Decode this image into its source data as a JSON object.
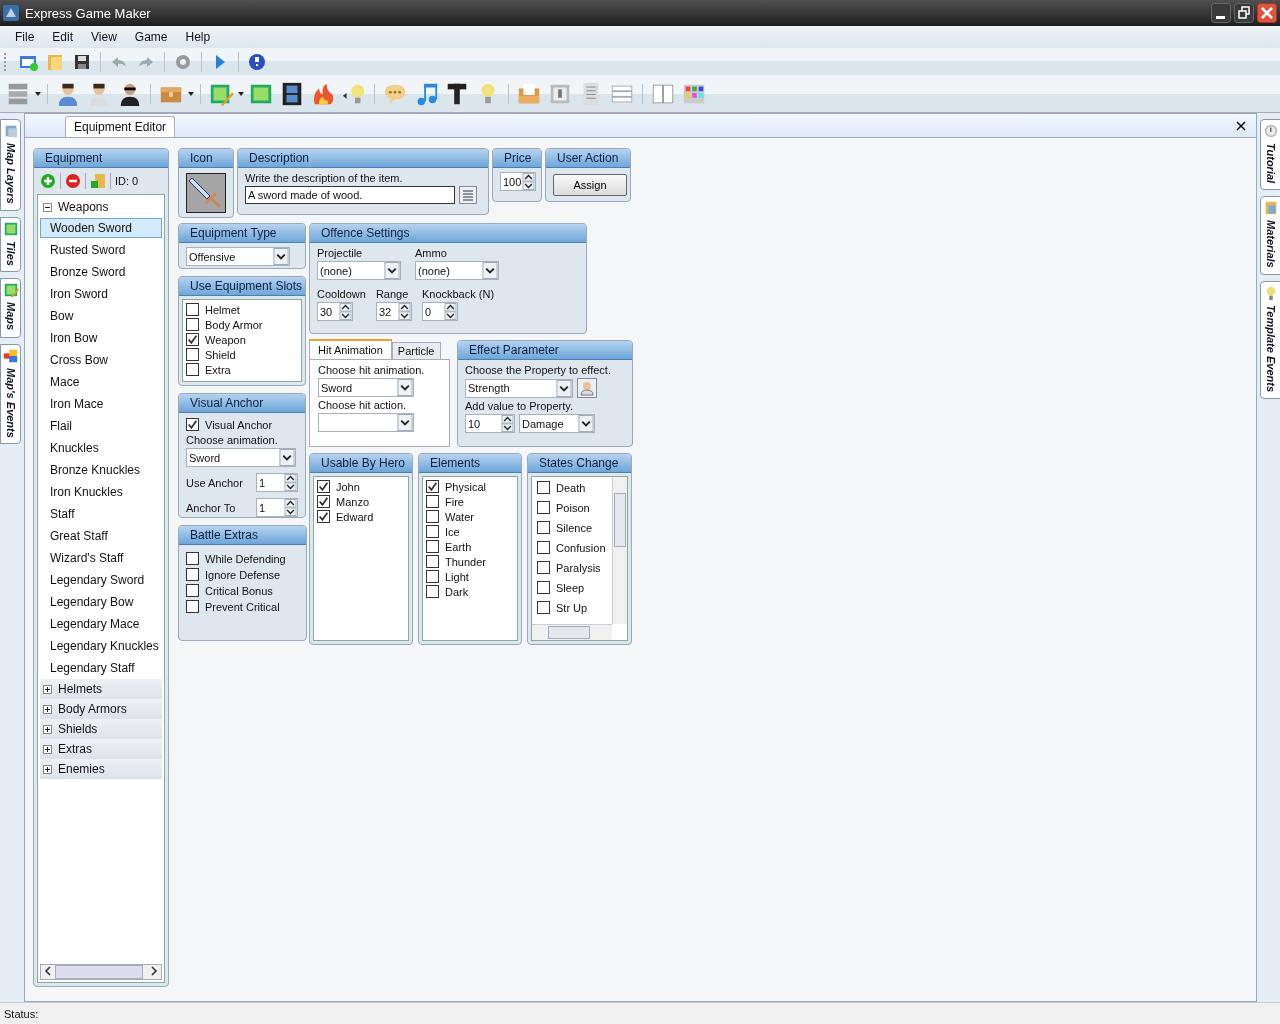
{
  "window": {
    "title": "Express Game Maker"
  },
  "menu": [
    "File",
    "Edit",
    "View",
    "Game",
    "Help"
  ],
  "left_dock_tabs": [
    "Map Layers",
    "Tiles",
    "Maps",
    "Map's Events"
  ],
  "right_dock_tabs": [
    "Tutorial",
    "Materials",
    "Template Events"
  ],
  "document_tab": {
    "label": "Equipment Editor"
  },
  "equipment": {
    "title": "Equipment",
    "id_label": "ID: 0",
    "tree": [
      {
        "label": "Weapons",
        "expanded": true,
        "children": [
          {
            "label": "Wooden Sword",
            "selected": true
          },
          {
            "label": "Rusted Sword",
            "selected": false
          },
          {
            "label": "Bronze Sword",
            "selected": false
          },
          {
            "label": "Iron Sword",
            "selected": false
          },
          {
            "label": "Bow",
            "selected": false
          },
          {
            "label": "Iron Bow",
            "selected": false
          },
          {
            "label": "Cross Bow",
            "selected": false
          },
          {
            "label": "Mace",
            "selected": false
          },
          {
            "label": "Iron Mace",
            "selected": false
          },
          {
            "label": "Flail",
            "selected": false
          },
          {
            "label": "Knuckles",
            "selected": false
          },
          {
            "label": "Bronze Knuckles",
            "selected": false
          },
          {
            "label": "Iron Knuckles",
            "selected": false
          },
          {
            "label": "Staff",
            "selected": false
          },
          {
            "label": "Great Staff",
            "selected": false
          },
          {
            "label": "Wizard's Staff",
            "selected": false
          },
          {
            "label": "Legendary Sword",
            "selected": false
          },
          {
            "label": "Legendary Bow",
            "selected": false
          },
          {
            "label": "Legendary Mace",
            "selected": false
          },
          {
            "label": "Legendary Knuckles",
            "selected": false
          },
          {
            "label": "Legendary Staff",
            "selected": false
          }
        ]
      },
      {
        "label": "Helmets",
        "expanded": false
      },
      {
        "label": "Body Armors",
        "expanded": false
      },
      {
        "label": "Shields",
        "expanded": false
      },
      {
        "label": "Extras",
        "expanded": false
      },
      {
        "label": "Enemies",
        "expanded": false
      }
    ]
  },
  "icon": {
    "title": "Icon"
  },
  "description": {
    "title": "Description",
    "hint": "Write the description of the item.",
    "value": "A sword made of wood."
  },
  "price": {
    "title": "Price",
    "value": "100"
  },
  "user_action": {
    "title": "User Action",
    "button": "Assign"
  },
  "equipment_type": {
    "title": "Equipment Type",
    "value": "Offensive"
  },
  "equipment_slots": {
    "title": "Use Equipment Slots",
    "items": [
      {
        "label": "Helmet",
        "checked": false
      },
      {
        "label": "Body Armor",
        "checked": false
      },
      {
        "label": "Weapon",
        "checked": true
      },
      {
        "label": "Shield",
        "checked": false
      },
      {
        "label": "Extra",
        "checked": false
      }
    ]
  },
  "visual_anchor": {
    "title": "Visual Anchor",
    "enabled": {
      "label": "Visual Anchor",
      "checked": true
    },
    "animation_label": "Choose animation.",
    "animation": "Sword",
    "spinners": [
      {
        "label": "Use Anchor",
        "value": "1"
      },
      {
        "label": "Anchor To",
        "value": "1"
      }
    ]
  },
  "battle_extras": {
    "title": "Battle Extras",
    "items": [
      {
        "label": "While Defending",
        "checked": false
      },
      {
        "label": "Ignore Defense",
        "checked": false
      },
      {
        "label": "Critical Bonus",
        "checked": false
      },
      {
        "label": "Prevent Critical",
        "checked": false
      }
    ]
  },
  "offence_settings": {
    "title": "Offence Settings",
    "dropdowns": [
      {
        "label": "Projectile",
        "value": "(none)"
      },
      {
        "label": "Ammo",
        "value": "(none)"
      }
    ],
    "spinners": [
      {
        "label": "Cooldown",
        "value": "30"
      },
      {
        "label": "Range",
        "value": "32"
      },
      {
        "label": "Knockback (N)",
        "value": "0"
      }
    ]
  },
  "hit_tabs": {
    "tabs": [
      {
        "label": "Hit Animation",
        "selected": true
      },
      {
        "label": "Particle",
        "selected": false
      }
    ],
    "animation_label": "Choose hit animation.",
    "animation": "Sword",
    "action_label": "Choose hit action."
  },
  "effect_parameter": {
    "title": "Effect Parameter",
    "property_label": "Choose the Property to effect.",
    "property": "Strength",
    "value_label": "Add value to Property.",
    "value": "10",
    "mode": "Damage"
  },
  "usable_by_hero": {
    "title": "Usable By Hero",
    "items": [
      {
        "label": "John",
        "checked": true
      },
      {
        "label": "Manzo",
        "checked": true
      },
      {
        "label": "Edward",
        "checked": true
      }
    ]
  },
  "elements": {
    "title": "Elements",
    "items": [
      {
        "label": "Physical",
        "checked": true
      },
      {
        "label": "Fire",
        "checked": false
      },
      {
        "label": "Water",
        "checked": false
      },
      {
        "label": "Ice",
        "checked": false
      },
      {
        "label": "Earth",
        "checked": false
      },
      {
        "label": "Thunder",
        "checked": false
      },
      {
        "label": "Light",
        "checked": false
      },
      {
        "label": "Dark",
        "checked": false
      }
    ]
  },
  "states_change": {
    "title": "States Change",
    "items": [
      {
        "label": "Death",
        "checked": false
      },
      {
        "label": "Poison",
        "checked": false
      },
      {
        "label": "Silence",
        "checked": false
      },
      {
        "label": "Confusion",
        "checked": false
      },
      {
        "label": "Paralysis",
        "checked": false
      },
      {
        "label": "Sleep",
        "checked": false
      },
      {
        "label": "Str Up",
        "checked": false
      }
    ]
  },
  "status_bar": {
    "label": "Status:"
  }
}
